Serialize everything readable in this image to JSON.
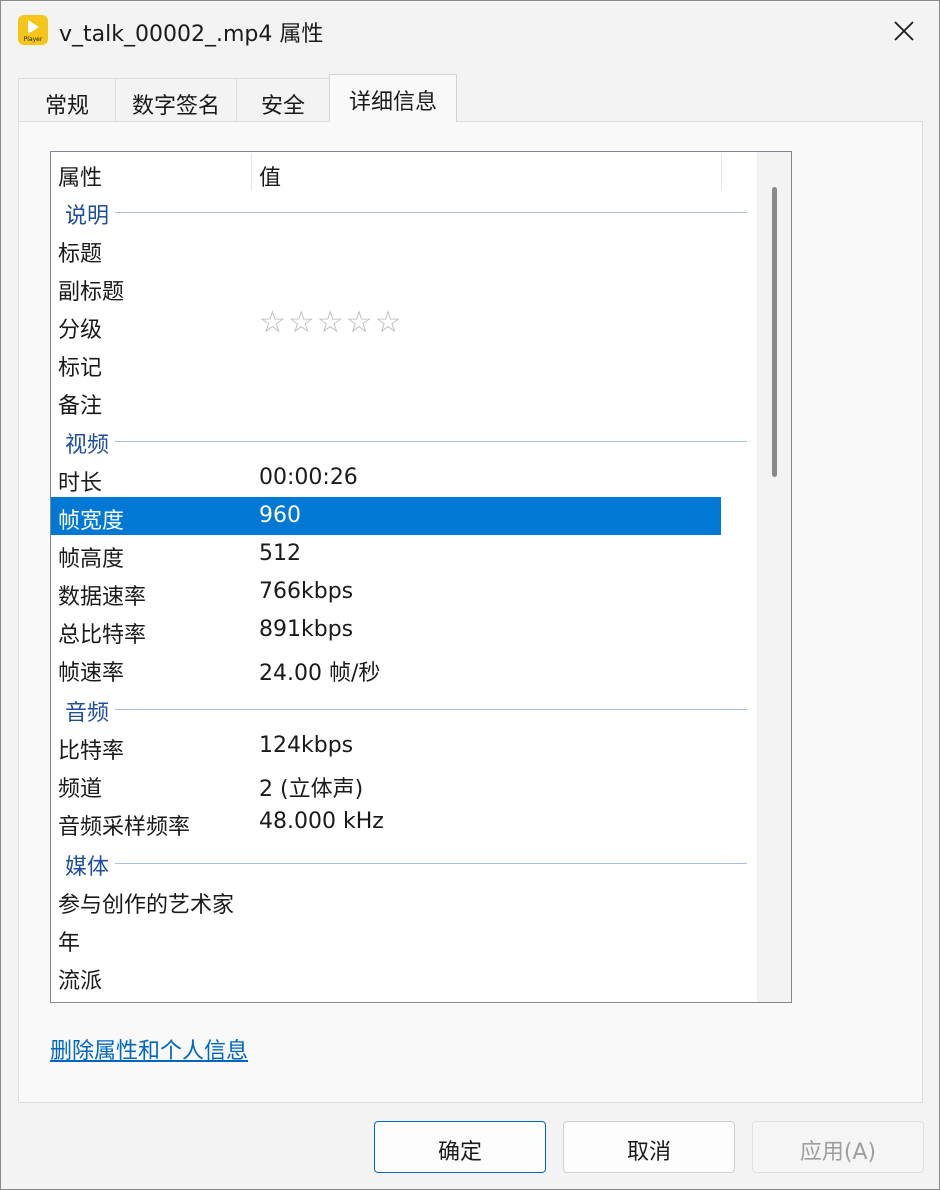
{
  "window": {
    "title": "v_talk_00002_.mp4 属性",
    "app_icon_label": "Player"
  },
  "tabs": [
    {
      "label": "常规",
      "active": false
    },
    {
      "label": "数字签名",
      "active": false
    },
    {
      "label": "安全",
      "active": false
    },
    {
      "label": "详细信息",
      "active": true
    }
  ],
  "list": {
    "columns": {
      "property": "属性",
      "value": "值"
    },
    "groups": {
      "description": "说明",
      "video": "视频",
      "audio": "音频",
      "media": "媒体"
    },
    "rows": {
      "title": {
        "key": "标题",
        "value": ""
      },
      "subtitle": {
        "key": "副标题",
        "value": ""
      },
      "rating": {
        "key": "分级",
        "stars": "☆☆☆☆☆",
        "value": 0,
        "max": 5
      },
      "tags": {
        "key": "标记",
        "value": ""
      },
      "comments": {
        "key": "备注",
        "value": ""
      },
      "duration": {
        "key": "时长",
        "value": "00:00:26"
      },
      "frame_width": {
        "key": "帧宽度",
        "value": "960"
      },
      "frame_height": {
        "key": "帧高度",
        "value": "512"
      },
      "data_rate": {
        "key": "数据速率",
        "value": "766kbps"
      },
      "total_bitrate": {
        "key": "总比特率",
        "value": "891kbps"
      },
      "frame_rate": {
        "key": "帧速率",
        "value": "24.00 帧/秒"
      },
      "bitrate": {
        "key": "比特率",
        "value": "124kbps"
      },
      "channels": {
        "key": "频道",
        "value": "2 (立体声)"
      },
      "sample_rate": {
        "key": "音频采样频率",
        "value": "48.000 kHz"
      },
      "contributing_artists": {
        "key": "参与创作的艺术家",
        "value": ""
      },
      "year": {
        "key": "年",
        "value": ""
      },
      "genre": {
        "key": "流派",
        "value": ""
      }
    },
    "selected_row": "frame_width"
  },
  "remove_link": "删除属性和个人信息",
  "buttons": {
    "ok": "确定",
    "cancel": "取消",
    "apply": "应用(A)"
  },
  "colors": {
    "selection": "#0078d4",
    "group_text": "#1e4e9e",
    "link": "#0067c0"
  }
}
